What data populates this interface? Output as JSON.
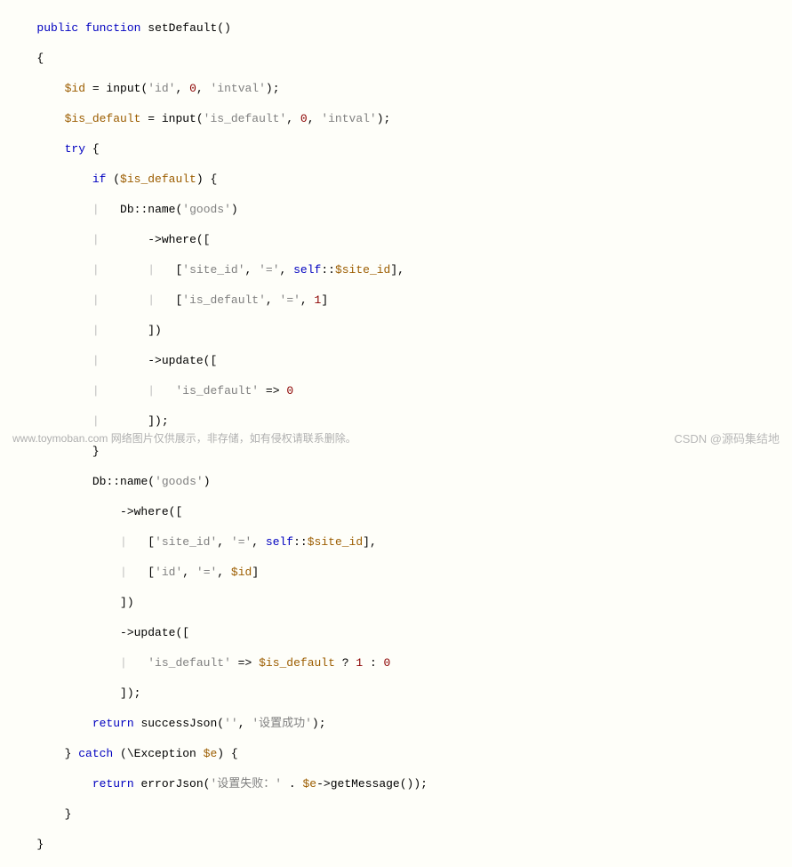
{
  "code": {
    "l1": {
      "kw1": "public",
      "kw2": "function",
      "name": "setDefault"
    },
    "l3": {
      "var": "$id",
      "fn": "input",
      "s": "'id'",
      "n": "0",
      "s2": "'intval'"
    },
    "l4": {
      "var": "$is_default",
      "fn": "input",
      "s": "'is_default'",
      "n": "0",
      "s2": "'intval'"
    },
    "l5": {
      "kw": "try"
    },
    "l6": {
      "kw": "if",
      "var": "$is_default"
    },
    "l7": {
      "cls": "Db",
      "fn": "name",
      "s": "'goods'"
    },
    "l8": {
      "fn": "where"
    },
    "l9": {
      "s": "'site_id'",
      "s2": "'='",
      "kw": "self",
      "var": "$site_id"
    },
    "l10": {
      "s": "'is_default'",
      "s2": "'='",
      "n": "1"
    },
    "l12": {
      "fn": "update"
    },
    "l13": {
      "s": "'is_default'",
      "n": "0"
    },
    "l16": {
      "cls": "Db",
      "fn": "name",
      "s": "'goods'"
    },
    "l17": {
      "fn": "where"
    },
    "l18": {
      "s": "'site_id'",
      "s2": "'='",
      "kw": "self",
      "var": "$site_id"
    },
    "l19": {
      "s": "'id'",
      "s2": "'='",
      "var": "$id"
    },
    "l21": {
      "fn": "update"
    },
    "l22": {
      "s": "'is_default'",
      "var": "$is_default",
      "n1": "1",
      "n2": "0"
    },
    "l24": {
      "kw": "return",
      "fn": "successJson",
      "s1": "''",
      "s2": "'设置成功'"
    },
    "l25": {
      "kw": "catch",
      "cls": "\\Exception",
      "var": "$e"
    },
    "l26": {
      "kw": "return",
      "fn": "errorJson",
      "s": "'设置失败：'",
      "var": "$e",
      "fn2": "getMessage"
    }
  },
  "footer": {
    "left": "www.toymoban.com 网络图片仅供展示，非存储，如有侵权请联系删除。",
    "right": "CSDN @源码集结地"
  }
}
